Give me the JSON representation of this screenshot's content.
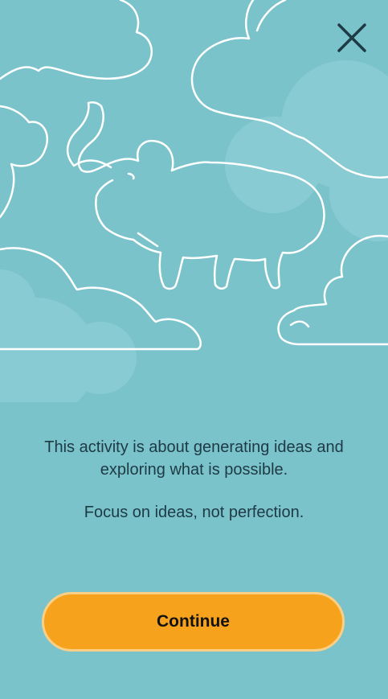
{
  "screen": {
    "background_color": "#7ac3cb",
    "illustration_icon": "elephant-in-clouds-icon"
  },
  "header": {
    "close_icon": "close-icon"
  },
  "content": {
    "message_primary": "This activity is about generating ideas and exploring what is possible.",
    "message_secondary": "Focus on ideas, not perfection."
  },
  "actions": {
    "continue_label": "Continue",
    "continue_color": "#f7a21d"
  }
}
